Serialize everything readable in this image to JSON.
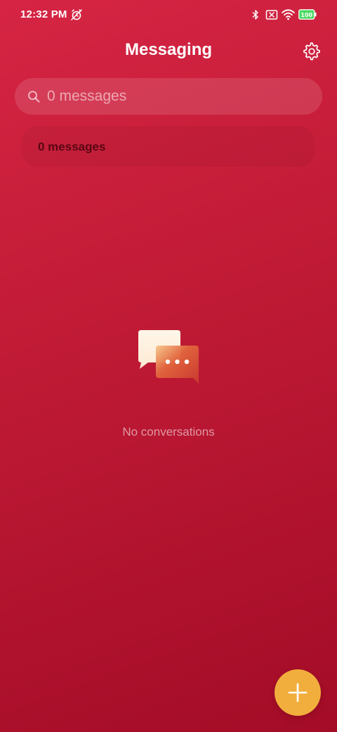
{
  "status_bar": {
    "time": "12:32 PM",
    "battery_level": "100",
    "icons": [
      "alarm-off-icon",
      "bluetooth-icon",
      "sim-x-icon",
      "wifi-icon",
      "battery-icon"
    ]
  },
  "header": {
    "title": "Messaging",
    "settings_icon": "gear-icon"
  },
  "search": {
    "placeholder": "0 messages",
    "value": ""
  },
  "summary": {
    "label": "0 messages"
  },
  "empty_state": {
    "icon": "chat-bubbles-icon",
    "text": "No conversations"
  },
  "fab": {
    "icon": "plus-icon",
    "color": "#f1ae3d"
  },
  "colors": {
    "background_top": "#d62544",
    "background_bottom": "#a30c27",
    "accent": "#f1ae3d"
  }
}
